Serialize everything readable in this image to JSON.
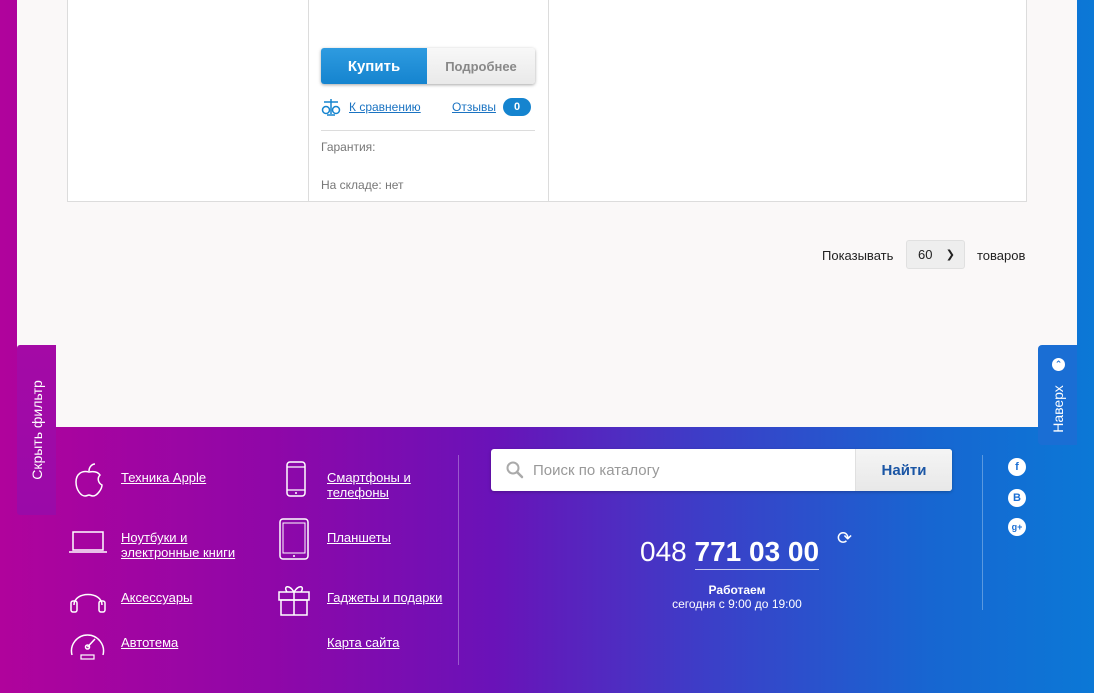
{
  "product": {
    "buy_label": "Купить",
    "details_label": "Подробнее",
    "compare_label": "К сравнению",
    "reviews_label": "Отзывы",
    "reviews_count": "0",
    "warranty_label": "Гарантия:",
    "stock_label": "На складе: нет"
  },
  "pagination": {
    "show_label": "Показывать",
    "per_page": "60",
    "suffix": "товаров"
  },
  "side": {
    "hide_filter": "Скрыть фильтр",
    "to_top": "Наверх"
  },
  "categories": {
    "apple": "Техника Apple",
    "smartphones_line1": "Смартфоны и",
    "smartphones_line2": "телефоны",
    "notebooks_line1": "Ноутбуки и",
    "notebooks_line2": "электронные книги",
    "tablets": "Планшеты",
    "accessories": "Аксессуары",
    "gadgets": "Гаджеты и подарки",
    "auto": "Автотема",
    "sitemap": "Карта сайта"
  },
  "search": {
    "placeholder": "Поиск по каталогу",
    "button": "Найти"
  },
  "contact": {
    "phone_prefix": "048",
    "phone_main": "771 03 00",
    "hours_title": "Работаем",
    "hours_time": "сегодня с 9:00 до 19:00"
  },
  "social": {
    "facebook": "f",
    "vk": "B",
    "google": "g+"
  },
  "colors": {
    "accent_blue": "#1584cf",
    "gradient_left": "#b0039c",
    "gradient_right": "#0b78d6"
  }
}
